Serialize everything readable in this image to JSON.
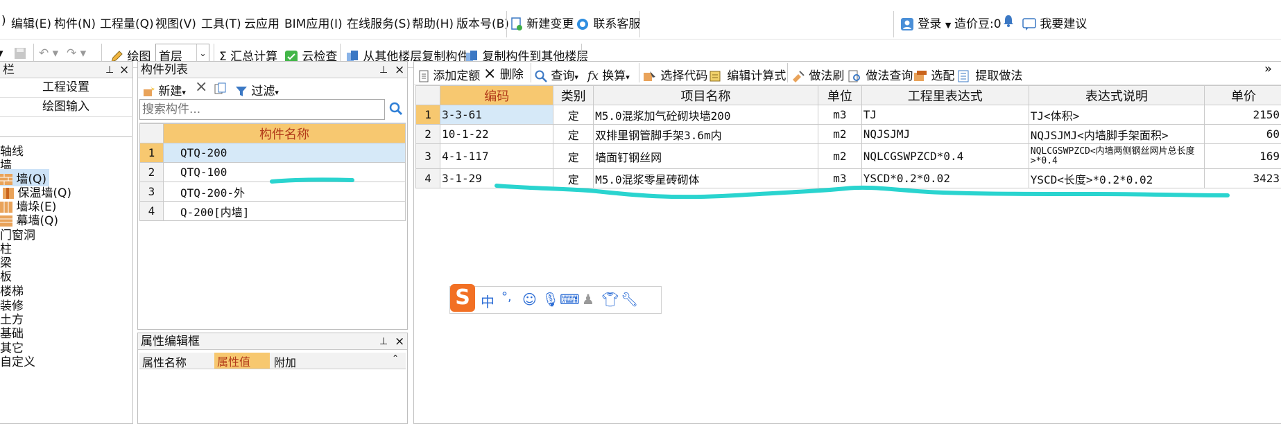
{
  "menubar": {
    "items": [
      "编辑(E)",
      "构件(N)",
      "工程量(Q)",
      "视图(V)",
      "工具(T)",
      "云应用",
      "BIM应用(I)",
      "在线服务(S)",
      "帮助(H)",
      "版本号(B)",
      "新建变更",
      "联系客服"
    ],
    "right": {
      "login": "登录",
      "price_beans": "造价豆:0",
      "suggest": "我要建议"
    }
  },
  "toolbar": {
    "draw": "绘图",
    "floor": "首层",
    "sum": "汇总计算",
    "cloud_check": "云检查",
    "copy_from": "从其他楼层复制构件",
    "copy_to": "复制构件到其他楼层"
  },
  "left_panel": {
    "title": "栏",
    "buttons": [
      "工程设置",
      "绘图输入"
    ],
    "tree": [
      "轴线",
      "墙",
      "墙(Q)",
      "保温墙(Q)",
      "墙垛(E)",
      "幕墙(Q)",
      "门窗洞",
      "柱",
      "梁",
      "板",
      "楼梯",
      "装修",
      "土方",
      "基础",
      "其它",
      "自定义"
    ]
  },
  "component_panel": {
    "title": "构件列表",
    "new_label": "新建",
    "filter_label": "过滤",
    "search_placeholder": "搜索构件...",
    "column": "构件名称",
    "rows": [
      {
        "n": "1",
        "name": "QTQ-200"
      },
      {
        "n": "2",
        "name": "QTQ-100"
      },
      {
        "n": "3",
        "name": "QTQ-200-外"
      },
      {
        "n": "4",
        "name": "Q-200[内墙]"
      }
    ]
  },
  "property_panel": {
    "title": "属性编辑框",
    "headers": [
      "属性名称",
      "属性值",
      "附加"
    ]
  },
  "quota_panel": {
    "toolbar": [
      "添加定额",
      "删除",
      "查询",
      "换算",
      "选择代码",
      "编辑计算式",
      "做法刷",
      "做法查询",
      "选配",
      "提取做法"
    ],
    "headers": [
      "编码",
      "类别",
      "项目名称",
      "单位",
      "工程里表达式",
      "表达式说明",
      "单价"
    ],
    "rows": [
      {
        "n": "1",
        "code": "3-3-61",
        "type": "定",
        "name": "M5.0混浆加气砼砌块墙200",
        "unit": "m3",
        "expr": "TJ",
        "desc": "TJ<体积>",
        "price": "2150"
      },
      {
        "n": "2",
        "code": "10-1-22",
        "type": "定",
        "name": "双排里钢管脚手架3.6m内",
        "unit": "m2",
        "expr": "NQJSJMJ",
        "desc": "NQJSJMJ<内墙脚手架面积>",
        "price": "60"
      },
      {
        "n": "3",
        "code": "4-1-117",
        "type": "定",
        "name": "墙面钉钢丝网",
        "unit": "m2",
        "expr": "NQLCGSWPZCD*0.4",
        "desc": "NQLCGSWPZCD<内墙两侧钢丝网片总长度>*0.4",
        "price": "169"
      },
      {
        "n": "4",
        "code": "3-1-29",
        "type": "定",
        "name": "M5.0混浆零星砖砌体",
        "unit": "m3",
        "expr": "YSCD*0.2*0.02",
        "desc": "YSCD<长度>*0.2*0.02",
        "price": "3423"
      }
    ]
  },
  "ime": {
    "mode": "中",
    "punct": "°,"
  },
  "colors": {
    "header_orange": "#f7c870",
    "selected_row": "#d6e9f8",
    "annotation": "#2ad4cf"
  }
}
